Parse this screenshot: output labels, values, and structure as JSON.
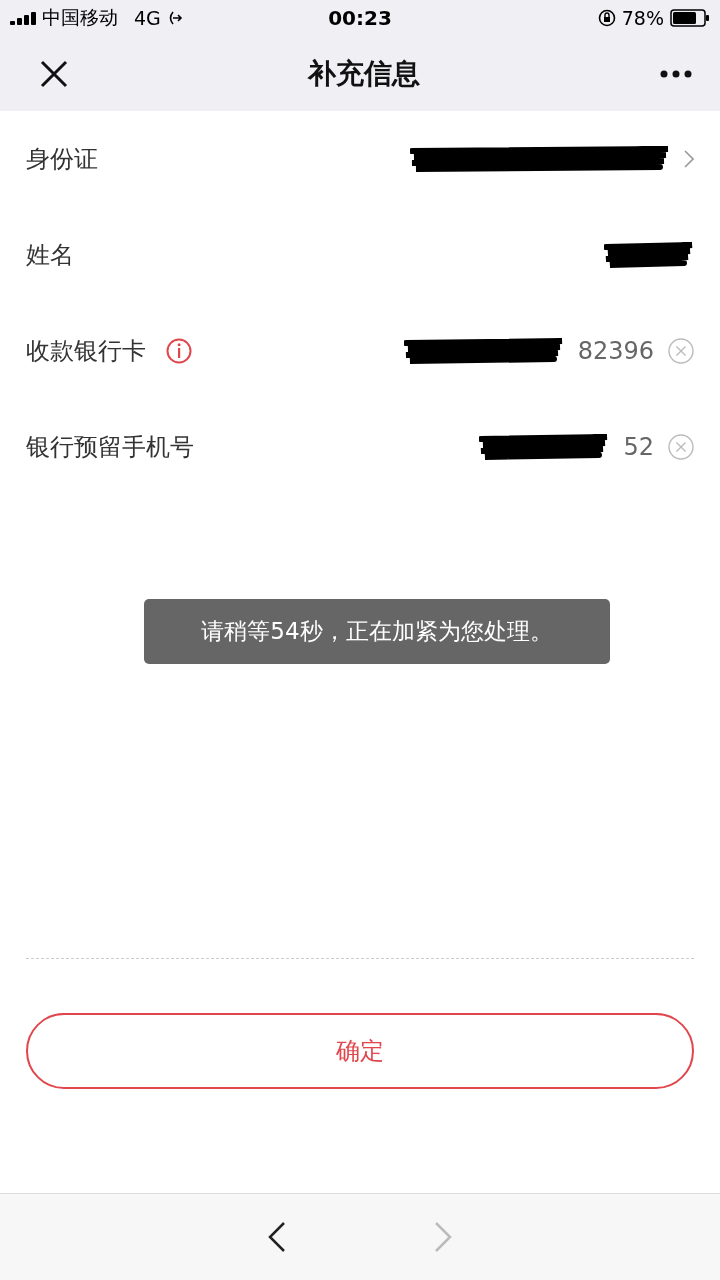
{
  "status_bar": {
    "carrier": "中国移动",
    "network": "4G",
    "time": "00:23",
    "battery": "78%"
  },
  "nav": {
    "title": "补充信息"
  },
  "fields": [
    {
      "label": "身份证",
      "kind": "link",
      "info": false,
      "redacted": true
    },
    {
      "label": "姓名",
      "kind": "text",
      "info": false,
      "redacted": true
    },
    {
      "label": "收款银行卡",
      "kind": "input",
      "info": true,
      "redacted": true,
      "value": "82396"
    },
    {
      "label": "银行预留手机号",
      "kind": "input",
      "info": false,
      "redacted": true,
      "value": "52"
    }
  ],
  "toast": "请稍等54秒，正在加紧为您处理。",
  "confirm_button": "确定",
  "browser_toolbar": {
    "back_disabled": false,
    "forward_disabled": true
  }
}
